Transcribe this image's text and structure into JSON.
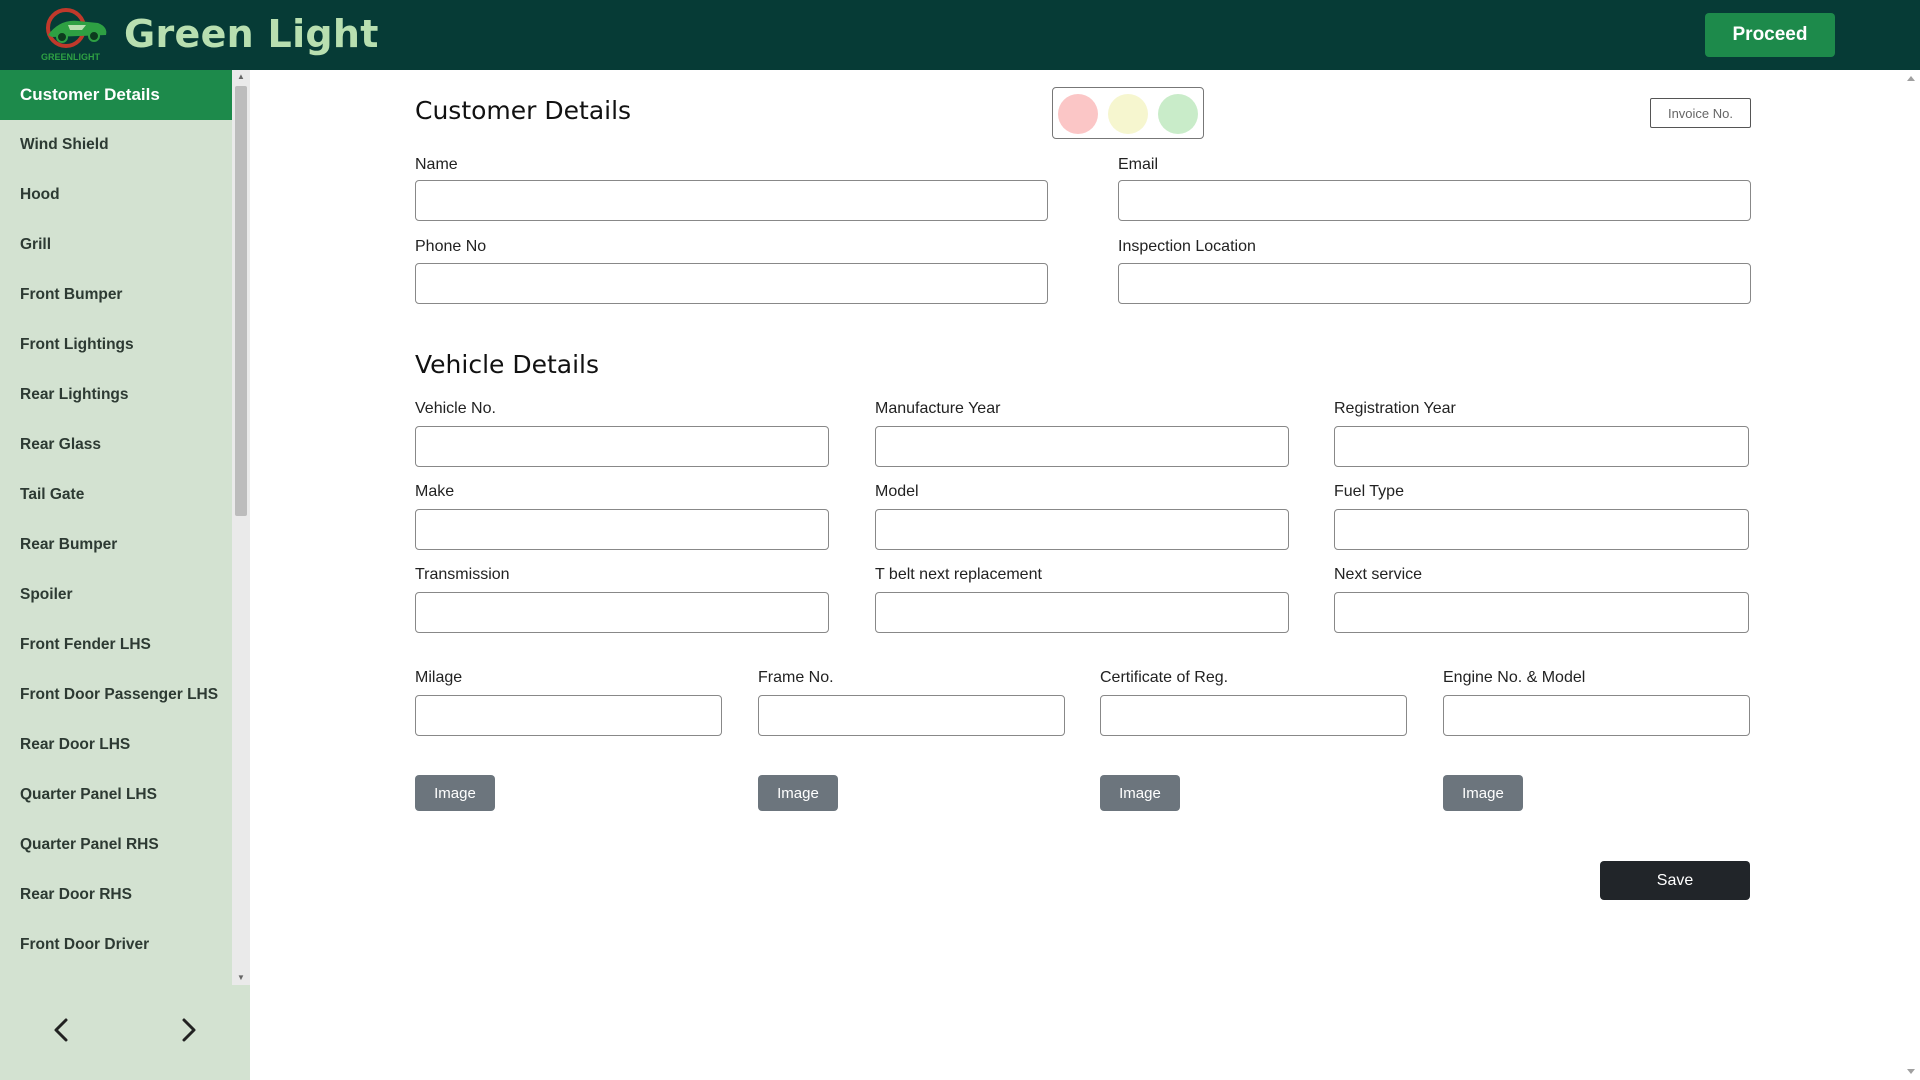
{
  "app": {
    "title": "Green Light",
    "logo_text": "GREENLIGHT",
    "brand_color": "#063b36",
    "accent": "#1d8a4b"
  },
  "header": {
    "proceed_label": "Proceed"
  },
  "sidebar": {
    "items": [
      {
        "label": "Customer Details",
        "active": true
      },
      {
        "label": "Wind Shield"
      },
      {
        "label": "Hood"
      },
      {
        "label": "Grill"
      },
      {
        "label": "Front Bumper"
      },
      {
        "label": "Front Lightings"
      },
      {
        "label": "Rear Lightings"
      },
      {
        "label": "Rear Glass"
      },
      {
        "label": "Tail Gate"
      },
      {
        "label": "Rear Bumper"
      },
      {
        "label": "Spoiler"
      },
      {
        "label": "Front Fender LHS"
      },
      {
        "label": "Front Door Passenger LHS"
      },
      {
        "label": "Rear Door LHS"
      },
      {
        "label": "Quarter Panel LHS"
      },
      {
        "label": "Quarter Panel RHS"
      },
      {
        "label": "Rear Door RHS"
      },
      {
        "label": "Front Door Driver"
      },
      {
        "label": ""
      }
    ],
    "prev_icon": "chevron-left-icon",
    "next_icon": "chevron-right-icon"
  },
  "customer": {
    "title": "Customer Details",
    "invoice_label": "Invoice No.",
    "traffic_lights": {
      "red": "#fbc6c6",
      "yellow": "#f6f6cf",
      "green": "#c9ecc9"
    },
    "fields": {
      "name": {
        "label": "Name",
        "value": ""
      },
      "email": {
        "label": "Email",
        "value": ""
      },
      "phone": {
        "label": "Phone No",
        "value": ""
      },
      "location": {
        "label": "Inspection Location",
        "value": ""
      }
    }
  },
  "vehicle": {
    "title": "Vehicle Details",
    "fields": {
      "vehicle_no": {
        "label": "Vehicle No.",
        "value": ""
      },
      "manufacture_year": {
        "label": "Manufacture Year",
        "value": ""
      },
      "registration_year": {
        "label": "Registration Year",
        "value": ""
      },
      "make": {
        "label": "Make",
        "value": ""
      },
      "model": {
        "label": "Model",
        "value": ""
      },
      "fuel_type": {
        "label": "Fuel Type",
        "value": ""
      },
      "transmission": {
        "label": "Transmission",
        "value": ""
      },
      "t_belt": {
        "label": "T belt next replacement",
        "value": ""
      },
      "next_service": {
        "label": "Next service",
        "value": ""
      },
      "milage": {
        "label": "Milage",
        "value": ""
      },
      "frame_no": {
        "label": "Frame No.",
        "value": ""
      },
      "certificate": {
        "label": "Certificate of Reg.",
        "value": ""
      },
      "engine": {
        "label": "Engine No. & Model",
        "value": ""
      }
    },
    "image_label": "Image",
    "save_label": "Save"
  }
}
